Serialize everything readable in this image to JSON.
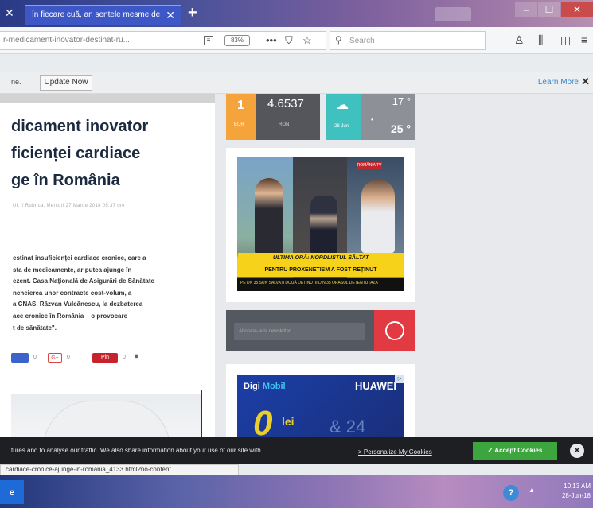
{
  "browser": {
    "tab_title": "În fiecare cuă, an sentele mesme de",
    "tab_close": "✕",
    "new_tab": "+",
    "window_close_left": "✕",
    "window_controls": {
      "minimize": "–",
      "maximize": "☐",
      "close": "✕"
    },
    "url": "r-medicament-inovator-destinat-ru...",
    "zoom": "83%",
    "search_placeholder": "Search",
    "more_ico": "•••"
  },
  "notification": {
    "text": "ne.",
    "update_label": "Update Now",
    "learn_more": "Learn More",
    "close": "✕"
  },
  "article": {
    "title_lines": [
      "dicament inovator",
      "ficienței cardiace",
      "ge în România"
    ],
    "meta": "Uk // Rubrica: Mercuri 27 Martie 2018 05:37 ore",
    "body_lines": [
      "estinat insuficienței cardiace cronice, care a",
      "sta de medicamente, ar putea ajunge în",
      "ezent. Casa Națională de Asigurări de Sănătate",
      "ncheierea unor contracte cost-volum, a",
      "a CNAS, Răzvan Vulcănescu, la dezbaterea",
      "ace cronice în România – o provocare",
      "t de sănătate\"."
    ],
    "share": {
      "fb_count": "0",
      "gplus": "G+",
      "gplus_count": "0",
      "pin": "Pin",
      "pin_count": "0"
    }
  },
  "widgets": {
    "currency": {
      "amount": "1",
      "from": "EUR",
      "rate": "4.6537",
      "to": "RON"
    },
    "weather": {
      "date": "28 Jun",
      "high": "17 °",
      "low": "25 °"
    },
    "video": {
      "tag": "ROMÂNIA TV",
      "banner1": "ULTIMA ORĂ: NORDLISTUL SĂLTAT",
      "banner2": "PENTRU PROXENETISM A FOST REȚINUT",
      "ticker": "PE DN 35 SUN SALVATI DOUĂ DETINUTII DIN 35 ORASUL DETENTUTAZA"
    },
    "newsletter": {
      "placeholder": "Abonare-te la newsletter"
    },
    "ad": {
      "brand": "Digi",
      "brand_sub": "Mobil",
      "partner": "HUAWEI",
      "big": "0",
      "unit": "lei",
      "promo": "& 24"
    }
  },
  "cookie": {
    "text": "tures and to analyse our traffic. We also share information about your use of our site with",
    "link": "> Personalize My Cookies",
    "accept": "✓ Accept Cookies",
    "close": "✕"
  },
  "status_url": "cardiace-cronice-ajunge-in-romania_4133.html?no-content",
  "taskbar": {
    "start": "e",
    "help": "?",
    "tray_arrow": "▲",
    "time": "10:13 AM",
    "date": "28-Jun-18"
  }
}
